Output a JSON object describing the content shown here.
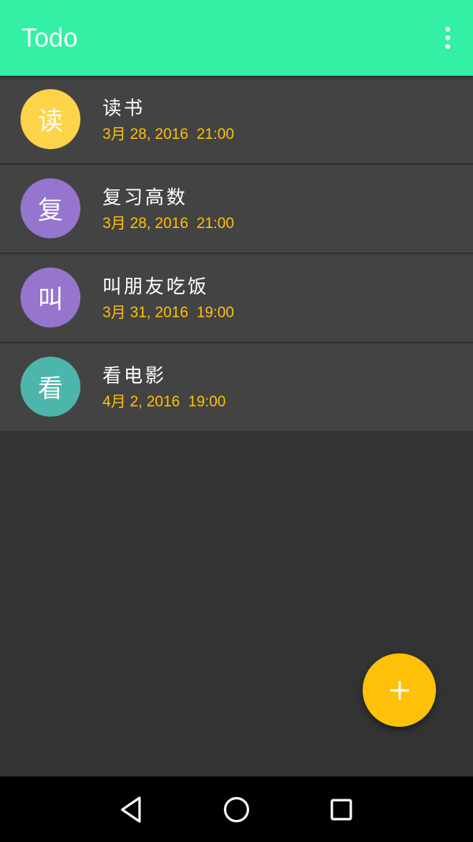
{
  "appbar": {
    "title": "Todo",
    "menu_icon": "more-vert-icon",
    "color": "#33f0a5"
  },
  "todos": [
    {
      "avatar": "读",
      "avatar_color": "#fdd34a",
      "title": "读书",
      "date": "3月 28, 2016  21:00"
    },
    {
      "avatar": "复",
      "avatar_color": "#9575cd",
      "title": "复习高数",
      "date": "3月 28, 2016  21:00"
    },
    {
      "avatar": "叫",
      "avatar_color": "#9575cd",
      "title": "叫朋友吃饭",
      "date": "3月 31, 2016  19:00"
    },
    {
      "avatar": "看",
      "avatar_color": "#4db6ac",
      "title": "看电影",
      "date": "4月 2, 2016  19:00"
    }
  ],
  "fab": {
    "icon": "plus-icon",
    "color": "#ffc107"
  },
  "navbar": {
    "back_icon": "back-triangle-icon",
    "home_icon": "home-circle-icon",
    "recents_icon": "recents-square-icon"
  },
  "colors": {
    "background": "#333333",
    "item_background": "#434343",
    "date_text": "#ffc107"
  }
}
